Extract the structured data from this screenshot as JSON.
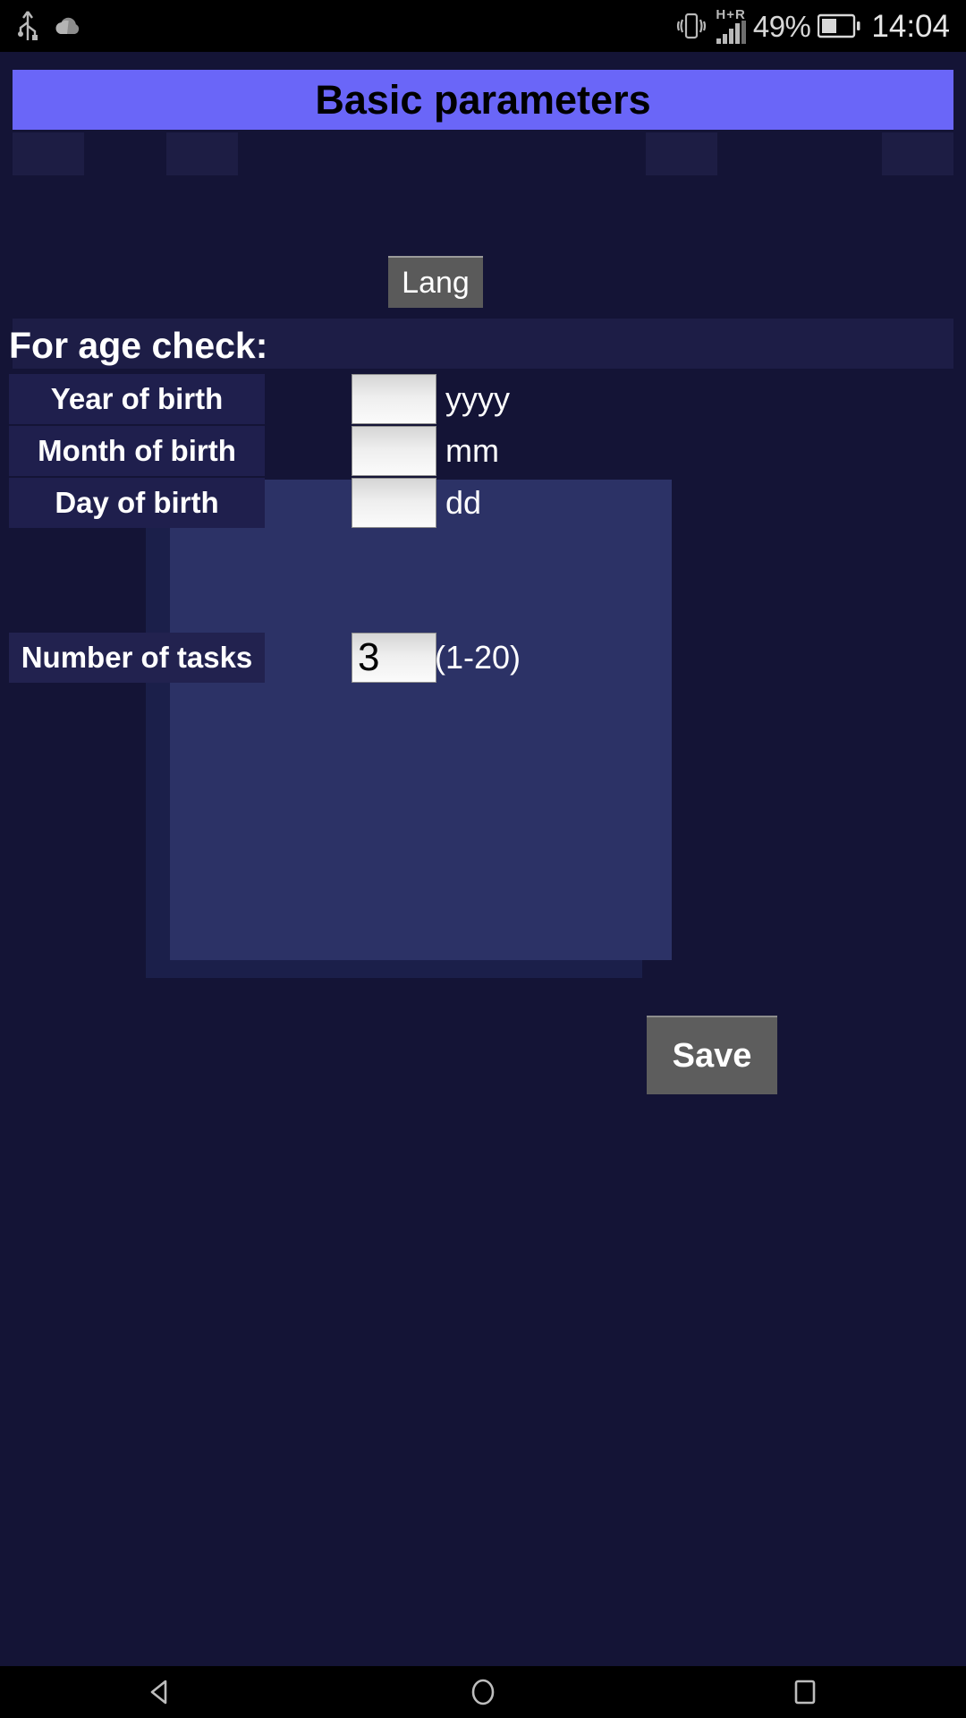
{
  "status_bar": {
    "left_icons": [
      "usb-icon",
      "cloud-icon"
    ],
    "vibrate_icon": "vibrate-icon",
    "network_type": "H+R",
    "signal_icon": "signal-bars-icon",
    "battery_percent": "49%",
    "battery_icon": "battery-icon",
    "clock": "14:04"
  },
  "app": {
    "title": "Basic parameters",
    "lang_button": "Lang",
    "age_heading": "For age check:",
    "fields": [
      {
        "label": "Year of birth",
        "value": "",
        "hint": "yyyy"
      },
      {
        "label": "Month of birth",
        "value": "",
        "hint": "mm"
      },
      {
        "label": "Day of birth",
        "value": "",
        "hint": "dd"
      }
    ],
    "tasks": {
      "label": "Number of tasks",
      "value": "3",
      "hint": "(1-20)"
    },
    "save_button": "Save",
    "colors": {
      "title_bar": "#6a66f8",
      "background": "#141436",
      "panel": "#2c3266",
      "button": "#5a5a5a",
      "label_bg": "#1f1f4d"
    }
  },
  "nav_bar": {
    "back": "back-icon",
    "home": "home-icon",
    "recents": "recents-icon"
  }
}
